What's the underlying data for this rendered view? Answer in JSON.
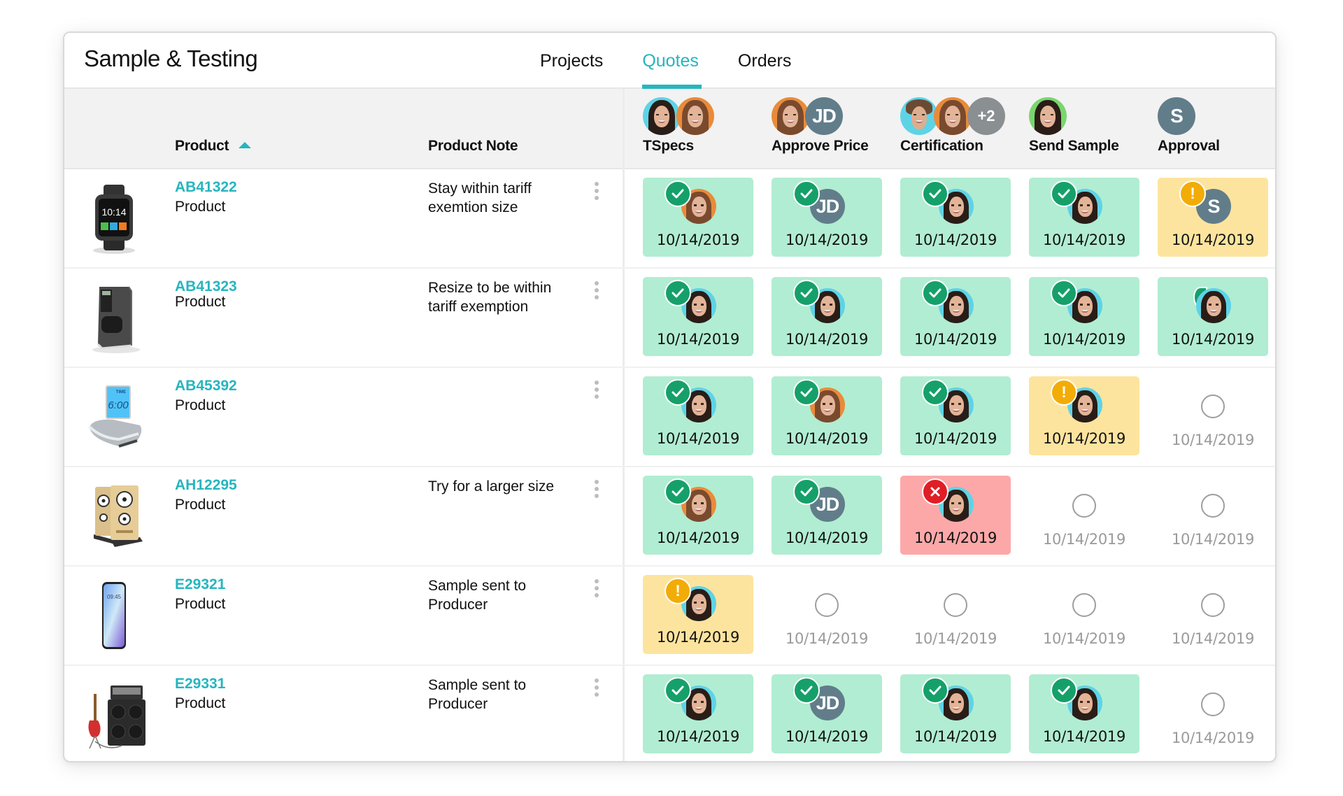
{
  "app": {
    "title": "Sample & Testing",
    "tabs": [
      {
        "label": "Projects",
        "active": false
      },
      {
        "label": "Quotes",
        "active": true
      },
      {
        "label": "Orders",
        "active": false
      }
    ],
    "accent_color": "#26b5bf"
  },
  "table": {
    "columns": {
      "product": "Product",
      "product_sort": "ascending",
      "product_note": "Product Note",
      "stages": [
        {
          "label": "TSpecs",
          "assignees": [
            "woman-a",
            "woman-b"
          ]
        },
        {
          "label": "Approve Price",
          "assignees": [
            "woman-b",
            "JD"
          ]
        },
        {
          "label": "Certification",
          "assignees": [
            "man-c",
            "woman-b",
            "+2"
          ]
        },
        {
          "label": "Send Sample",
          "assignees": [
            "woman-d"
          ]
        },
        {
          "label": "Approval",
          "assignees": [
            "S"
          ]
        }
      ]
    },
    "status_colors": {
      "approved": "#b1edd2",
      "warning": "#fde49e",
      "rejected": "#fda8a8"
    },
    "rows": [
      {
        "id": "AB41322",
        "type": "Product",
        "note": "Stay within tariff exemtion size",
        "image": "smartwatch",
        "image_text": "10:14",
        "stages": [
          {
            "status": "approved",
            "assignee": "woman-b",
            "date": "10/14/2019"
          },
          {
            "status": "approved",
            "assignee": "JD",
            "date": "10/14/2019"
          },
          {
            "status": "approved",
            "assignee": "woman-a",
            "date": "10/14/2019"
          },
          {
            "status": "approved",
            "assignee": "woman-a",
            "date": "10/14/2019"
          },
          {
            "status": "warning",
            "assignee": "S",
            "date": "10/14/2019"
          }
        ]
      },
      {
        "id": "AB41323",
        "type": "Product",
        "note": "Resize to be within tariff exemption",
        "image": "coffee-maker",
        "image_text": "",
        "stages": [
          {
            "status": "approved",
            "assignee": "woman-a",
            "date": "10/14/2019"
          },
          {
            "status": "approved",
            "assignee": "woman-a",
            "date": "10/14/2019"
          },
          {
            "status": "approved",
            "assignee": "woman-a",
            "date": "10/14/2019"
          },
          {
            "status": "approved",
            "assignee": "woman-a",
            "date": "10/14/2019"
          },
          {
            "status": "approved-nobadge",
            "assignee": "woman-a",
            "date": "10/14/2019"
          }
        ]
      },
      {
        "id": "AB45392",
        "type": "Product",
        "note": "",
        "image": "alarm-clock",
        "image_text": "6:00",
        "stages": [
          {
            "status": "approved",
            "assignee": "woman-a",
            "date": "10/14/2019"
          },
          {
            "status": "approved",
            "assignee": "woman-b",
            "date": "10/14/2019"
          },
          {
            "status": "approved",
            "assignee": "woman-a",
            "date": "10/14/2019"
          },
          {
            "status": "warning",
            "assignee": "woman-a",
            "date": "10/14/2019"
          },
          {
            "status": "pending",
            "assignee": "",
            "date": "10/14/2019"
          }
        ]
      },
      {
        "id": "AH12295",
        "type": "Product",
        "note": "Try for a larger size",
        "image": "speakers",
        "image_text": "",
        "stages": [
          {
            "status": "approved",
            "assignee": "woman-b",
            "date": "10/14/2019"
          },
          {
            "status": "approved",
            "assignee": "JD",
            "date": "10/14/2019"
          },
          {
            "status": "rejected",
            "assignee": "woman-a",
            "date": "10/14/2019"
          },
          {
            "status": "pending",
            "assignee": "",
            "date": "10/14/2019"
          },
          {
            "status": "pending",
            "assignee": "",
            "date": "10/14/2019"
          }
        ]
      },
      {
        "id": "E29321",
        "type": "Product",
        "note": "Sample sent to Producer",
        "image": "smartphone",
        "image_text": "09:45",
        "stages": [
          {
            "status": "warning",
            "assignee": "woman-a",
            "date": "10/14/2019"
          },
          {
            "status": "pending",
            "assignee": "",
            "date": "10/14/2019"
          },
          {
            "status": "pending",
            "assignee": "",
            "date": "10/14/2019"
          },
          {
            "status": "pending",
            "assignee": "",
            "date": "10/14/2019"
          },
          {
            "status": "pending",
            "assignee": "",
            "date": "10/14/2019"
          }
        ]
      },
      {
        "id": "E29331",
        "type": "Product",
        "note": "Sample sent to Producer",
        "image": "guitar-amplifier",
        "image_text": "",
        "stages": [
          {
            "status": "approved",
            "assignee": "woman-a",
            "date": "10/14/2019"
          },
          {
            "status": "approved",
            "assignee": "JD",
            "date": "10/14/2019"
          },
          {
            "status": "approved",
            "assignee": "woman-a",
            "date": "10/14/2019"
          },
          {
            "status": "approved",
            "assignee": "woman-a",
            "date": "10/14/2019"
          },
          {
            "status": "pending",
            "assignee": "",
            "date": "10/14/2019"
          }
        ]
      }
    ]
  }
}
